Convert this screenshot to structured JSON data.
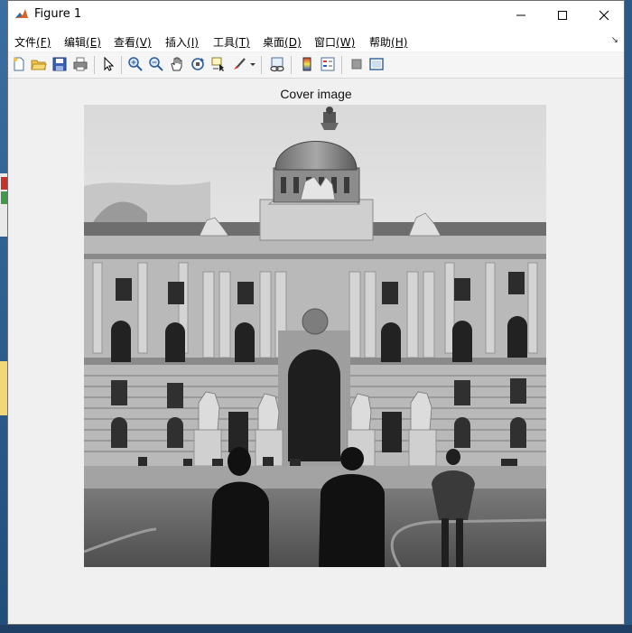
{
  "window": {
    "title": "Figure 1",
    "controls": [
      "minimize",
      "maximize",
      "close"
    ]
  },
  "menu": {
    "items": [
      {
        "label": "文件",
        "accel": "(F)"
      },
      {
        "label": "编辑",
        "accel": "(E)"
      },
      {
        "label": "查看",
        "accel": "(V)"
      },
      {
        "label": "插入",
        "accel": "(I)"
      },
      {
        "label": "工具",
        "accel": "(T)"
      },
      {
        "label": "桌面",
        "accel": "(D)"
      },
      {
        "label": "窗口",
        "accel": "(W)"
      },
      {
        "label": "帮助",
        "accel": "(H)"
      }
    ]
  },
  "toolbar": {
    "icons": [
      "new-figure-icon",
      "open-icon",
      "save-icon",
      "print-icon",
      "select-arrow-icon",
      "zoom-in-icon",
      "zoom-out-icon",
      "pan-hand-icon",
      "rotate-3d-icon",
      "data-cursor-icon",
      "brush-icon",
      "link-plot-icon",
      "colorbar-icon",
      "legend-icon",
      "hide-plot-tools-icon",
      "show-plot-tools-icon"
    ]
  },
  "figure": {
    "axes_title": "Cover image",
    "image_content": "grayscale photo of palace building"
  },
  "colors": {
    "window_bg": "#f0f0f0",
    "titlebar_bg": "#ffffff",
    "desktop": "#2b5a86"
  }
}
